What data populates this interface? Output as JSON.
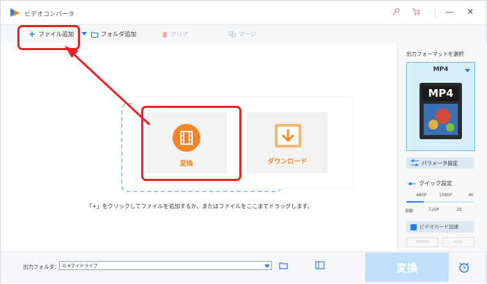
{
  "window": {
    "title": "ビデオコンバータ",
    "key_icon": "key-icon",
    "cart_icon": "cart-icon",
    "minimize": "—",
    "close": "✕"
  },
  "toolbar": {
    "add_file": "ファイル追加",
    "add_folder": "フォルダ追加",
    "clear": "クリア",
    "merge": "マージ"
  },
  "main": {
    "convert_tile": "変換",
    "download_tile": "ダウンロード",
    "hint": "「+」をクリックしてファイルを追加するか、またはファイルをここまでドラッグします。"
  },
  "right_panel": {
    "heading": "出力フォーマットを選択",
    "format": "MP4",
    "format_art_text": "MP4",
    "parameter_settings": "パラメータ設定",
    "quick_settings": "クイック設定",
    "res_top": [
      "480P",
      "1080P",
      "4K"
    ],
    "res_bottom": [
      "自動",
      "720P",
      "2K"
    ],
    "gpu_accel": "ビデオカード加速",
    "nvidia": "NVIDIA",
    "intel": "Intel"
  },
  "bottom": {
    "output_folder_label": "出力フォルダ：",
    "output_path": "G:¥マイドライブ",
    "convert_button": "変換"
  },
  "colors": {
    "accent_blue": "#2a7de1",
    "accent_orange": "#f2842a",
    "annotation_red": "#e52323",
    "convert_button_bg": "#bfe0fb"
  }
}
